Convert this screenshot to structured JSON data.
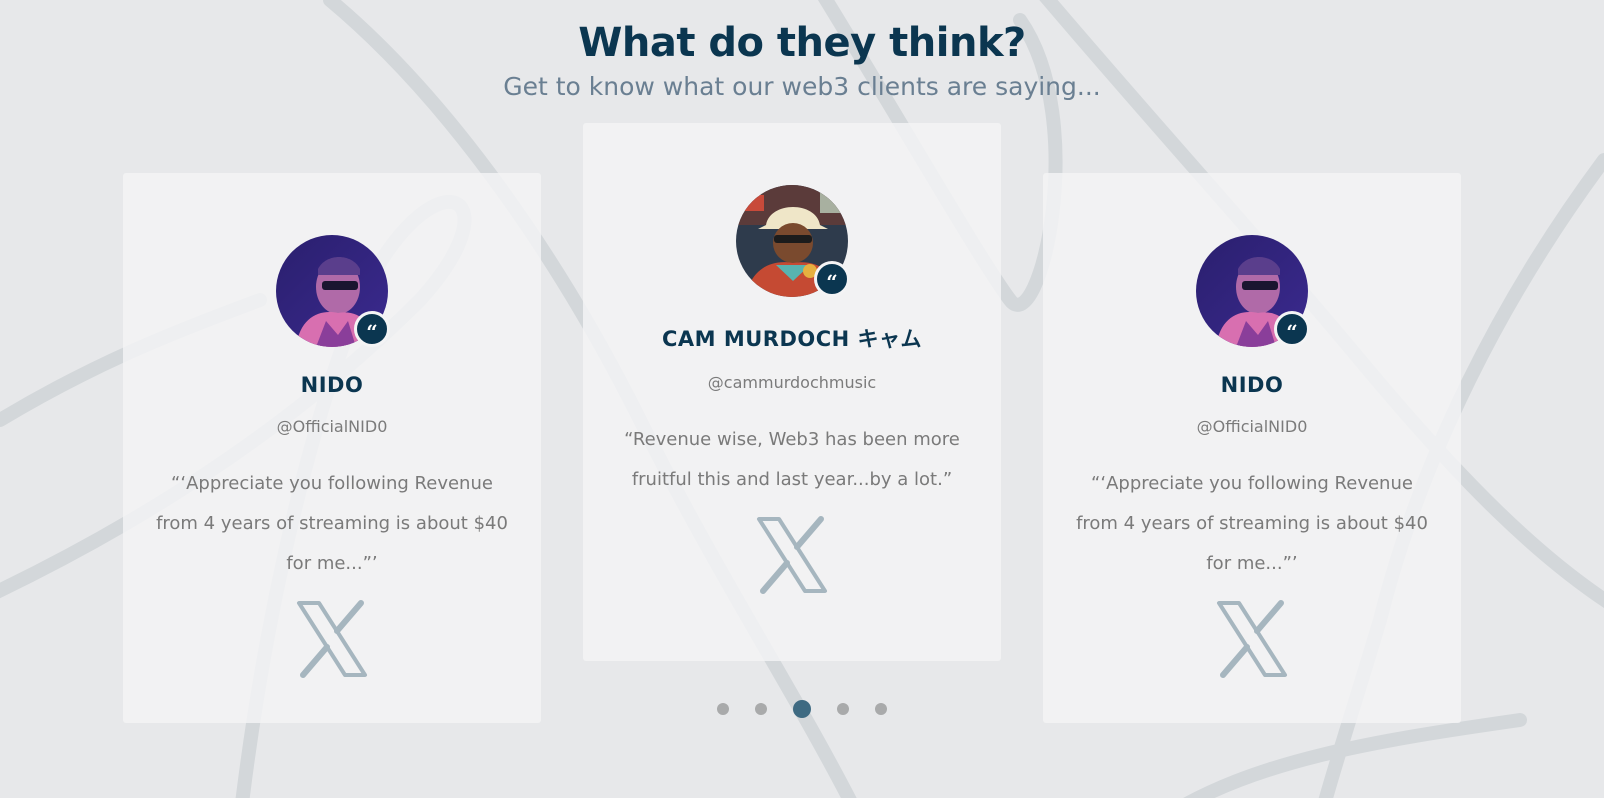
{
  "header": {
    "title": "What do they think?",
    "subtitle": "Get to know what our web3 clients are saying..."
  },
  "testimonials": [
    {
      "name": "NIDO",
      "handle": "@OfficialNID0",
      "quote": "“‘Appreciate you following Revenue from 4 years of streaming is about $40 for me...”’",
      "social_icon": "x-icon",
      "avatar": "avatar-nido"
    },
    {
      "name": "CAM MURDOCH キャム",
      "handle": "@cammurdochmusic",
      "quote": "“Revenue wise, Web3 has been more fruitful this and last year...by a lot.”",
      "social_icon": "x-icon",
      "avatar": "avatar-cam"
    },
    {
      "name": "NIDO",
      "handle": "@OfficialNID0",
      "quote": "“‘Appreciate you following Revenue from 4 years of streaming is about $40 for me...”’",
      "social_icon": "x-icon",
      "avatar": "avatar-nido"
    }
  ],
  "badge": {
    "glyph": "“"
  },
  "pagination": {
    "count": 5,
    "active_index": 2
  },
  "colors": {
    "background": "#e7e8ea",
    "title": "#0b3650",
    "subtitle": "#6a7f92",
    "card": "#f4f4f5",
    "x_logo": "#a6b6bf",
    "active_dot": "#3e6a82"
  }
}
